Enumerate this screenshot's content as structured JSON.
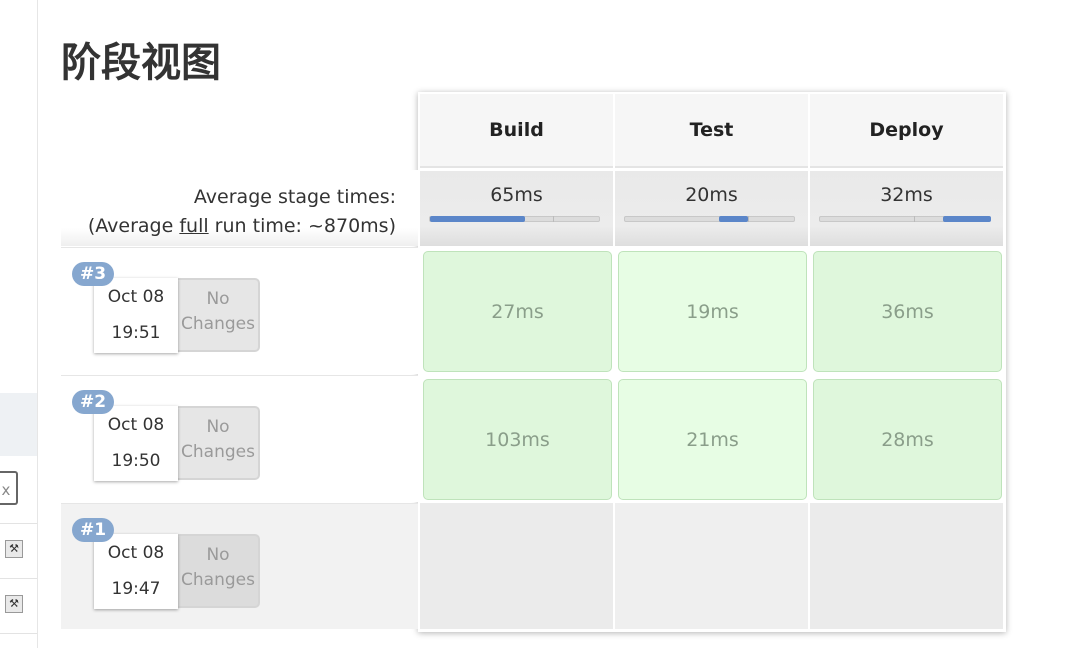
{
  "page": {
    "title": "阶段视图"
  },
  "sidebar": {
    "close_glyph": "x"
  },
  "stages": [
    {
      "name": "Build",
      "avg": "65ms"
    },
    {
      "name": "Test",
      "avg": "20ms"
    },
    {
      "name": "Deploy",
      "avg": "32ms"
    }
  ],
  "avg_label": {
    "line1": "Average stage times:",
    "line2_prefix": "(Average ",
    "line2_link": "full",
    "line2_suffix": " run time: ~870ms)"
  },
  "runs": [
    {
      "id": "#3",
      "date": "Oct 08",
      "time": "19:51",
      "changes_line1": "No",
      "changes_line2": "Changes",
      "stage_times": [
        "27ms",
        "19ms",
        "36ms"
      ]
    },
    {
      "id": "#2",
      "date": "Oct 08",
      "time": "19:50",
      "changes_line1": "No",
      "changes_line2": "Changes",
      "stage_times": [
        "103ms",
        "21ms",
        "28ms"
      ]
    },
    {
      "id": "#1",
      "date": "Oct 08",
      "time": "19:47",
      "changes_line1": "No",
      "changes_line2": "Changes",
      "stage_times": []
    }
  ],
  "colors": {
    "stage_success": "#dff7dc",
    "badge": "#86a7cf",
    "progress": "#5b86c9"
  }
}
